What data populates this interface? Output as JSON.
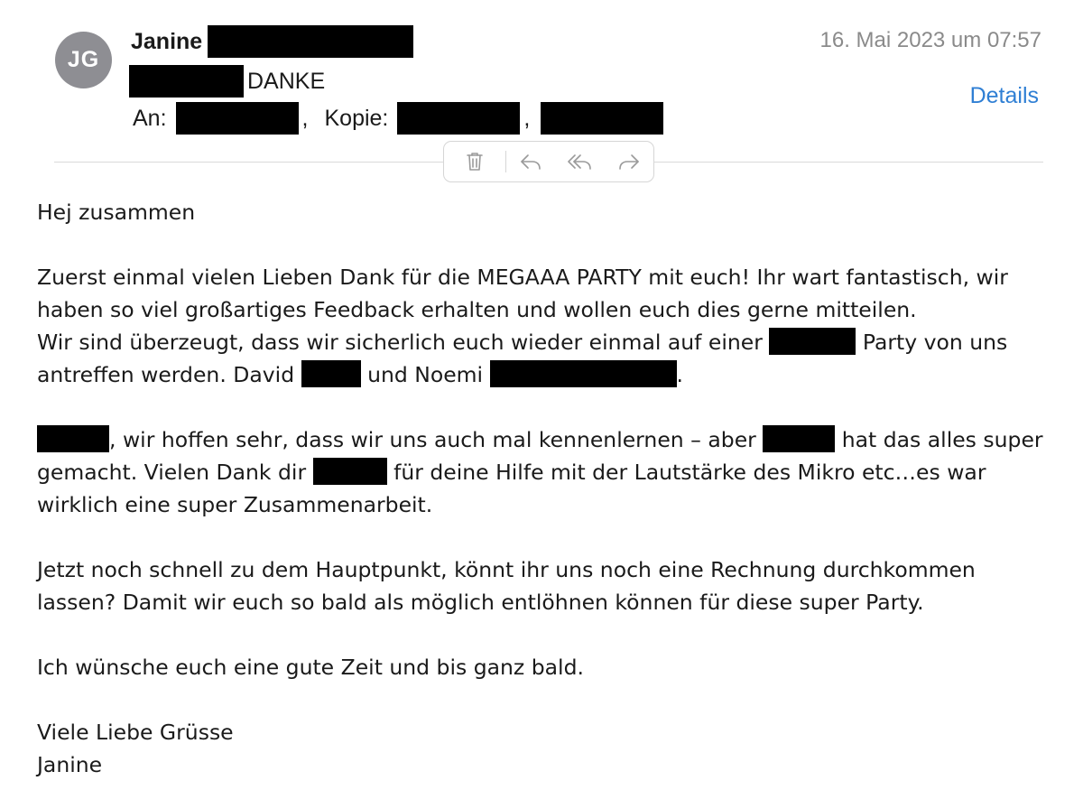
{
  "header": {
    "avatar_initials": "JG",
    "sender_name": "Janine",
    "subject": "DANKE",
    "to_label": "An:",
    "cc_label": "Kopie:",
    "date": "16. Mai 2023 um 07:57",
    "details_label": "Details"
  },
  "toolbar": {
    "delete_icon": "trash-icon",
    "reply_icon": "reply-icon",
    "reply_all_icon": "reply-all-icon",
    "forward_icon": "forward-icon"
  },
  "body": {
    "greeting": "Hej zusammen",
    "p1_l1": "Zuerst einmal vielen Lieben Dank für die MEGAAA PARTY mit euch! Ihr wart fantastisch, wir",
    "p1_l2": "haben so viel großartiges Feedback erhalten und wollen euch dies gerne mitteilen.",
    "p1_l3a": "Wir sind überzeugt, dass wir sicherlich euch wieder einmal auf einer ",
    "p1_l3b": " Party von uns",
    "p1_l4a": "antreffen werden. David ",
    "p1_l4b": " und Noemi ",
    "p1_l4c": ".",
    "p2_l1a": ", wir hoffen sehr, dass wir uns auch mal kennenlernen – aber ",
    "p2_l1b": " hat das alles super",
    "p2_l2a": "gemacht. Vielen Dank dir ",
    "p2_l2b": " für deine Hilfe mit der Lautstärke des Mikro etc…es war",
    "p2_l3": "wirklich eine super Zusammenarbeit.",
    "p3_l1": "Jetzt noch schnell zu dem Hauptpunkt, könnt ihr uns noch eine Rechnung durchkommen",
    "p3_l2": "lassen? Damit wir euch so bald als möglich entlöhnen können für diese super Party.",
    "p4": "Ich wünsche euch eine gute Zeit und bis ganz bald.",
    "closing": "Viele Liebe Grüsse",
    "signature": "Janine"
  },
  "colors": {
    "link": "#2f7fd4",
    "date": "#8a8a8a",
    "avatar": "#8e8e93",
    "redaction": "#000000"
  }
}
